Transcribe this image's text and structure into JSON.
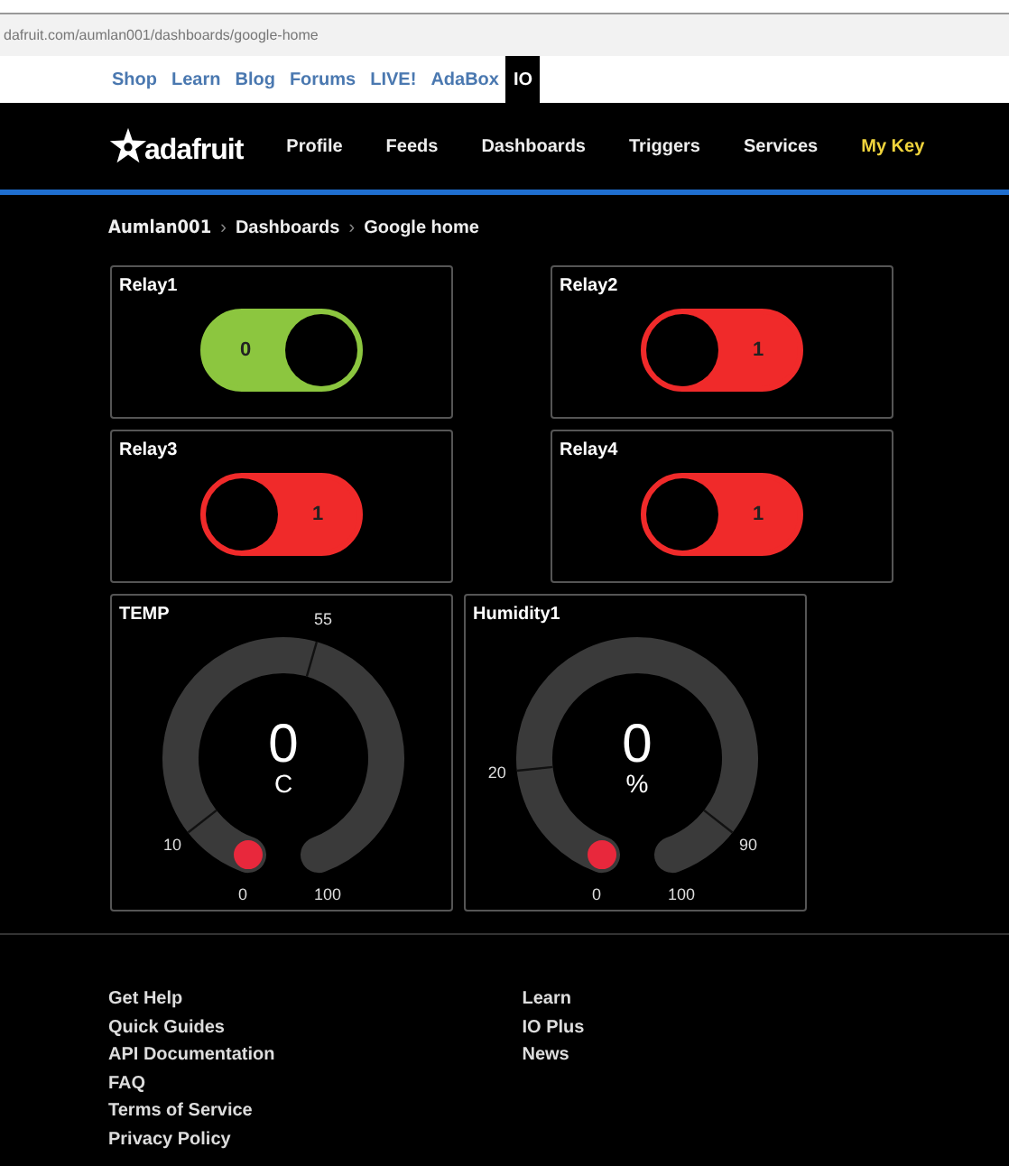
{
  "browser": {
    "url": "dafruit.com/aumlan001/dashboards/google-home"
  },
  "site_nav": [
    {
      "label": "Shop",
      "selected": false
    },
    {
      "label": "Learn",
      "selected": false
    },
    {
      "label": "Blog",
      "selected": false
    },
    {
      "label": "Forums",
      "selected": false
    },
    {
      "label": "LIVE!",
      "selected": false
    },
    {
      "label": "AdaBox",
      "selected": false
    },
    {
      "label": "IO",
      "selected": true
    }
  ],
  "header": {
    "logo": "adafruit",
    "nav": [
      {
        "label": "Profile",
        "highlighted": false
      },
      {
        "label": "Feeds",
        "highlighted": false
      },
      {
        "label": "Dashboards",
        "highlighted": false
      },
      {
        "label": "Triggers",
        "highlighted": false
      },
      {
        "label": "Services",
        "highlighted": false
      },
      {
        "label": "My Key",
        "highlighted": true
      }
    ]
  },
  "breadcrumb": {
    "separator": "›",
    "items": [
      "Aumlan001",
      "Dashboards",
      "Google home"
    ]
  },
  "toggles": [
    {
      "title": "Relay1",
      "value": "0",
      "on": false
    },
    {
      "title": "Relay2",
      "value": "1",
      "on": true
    },
    {
      "title": "Relay3",
      "value": "1",
      "on": true
    },
    {
      "title": "Relay4",
      "value": "1",
      "on": true
    }
  ],
  "gauges": [
    {
      "title": "TEMP",
      "value": "0",
      "unit": "C",
      "min": "0",
      "max": "100",
      "ticks": [
        "10",
        "55"
      ]
    },
    {
      "title": "Humidity1",
      "value": "0",
      "unit": "%",
      "min": "0",
      "max": "100",
      "ticks": [
        "20",
        "90"
      ]
    }
  ],
  "footer": {
    "column_1": [
      "Get Help",
      "Quick Guides",
      "API Documentation",
      "FAQ",
      "Terms of Service",
      "Privacy Policy"
    ],
    "column_2": [
      "Learn",
      "IO Plus",
      "News"
    ]
  }
}
